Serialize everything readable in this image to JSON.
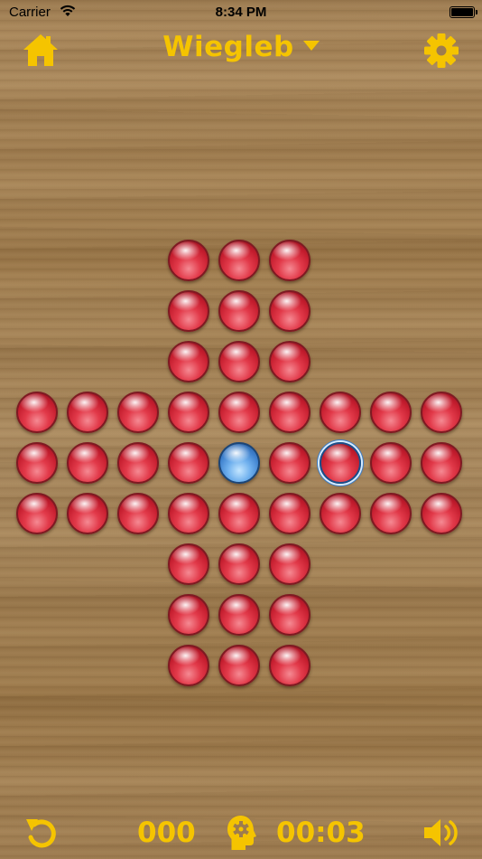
{
  "status_bar": {
    "carrier": "Carrier",
    "time": "8:34 PM",
    "icons": [
      "wifi-icon",
      "battery-icon"
    ]
  },
  "header": {
    "title": "Wiegleb",
    "home_icon": "home-icon",
    "settings_icon": "gear-icon",
    "dropdown_icon": "chevron-down-icon"
  },
  "board": {
    "layout": "cross",
    "grid_size": 9,
    "peg_color": "#d92a3c",
    "empty_hole_color": "#4f91dd",
    "selection_ring_color": "#3e7dc4",
    "rows": [
      "...XXX...",
      "...XXX...",
      "...XXX...",
      "XXXXXXXXX",
      "XXXXOXSXX",
      "XXXXXXXXX",
      "...XXX...",
      "...XXX...",
      "...XXX..."
    ],
    "legend_note_internal": null
  },
  "footer": {
    "undo_icon": "undo-icon",
    "moves": "000",
    "hint_icon": "hint-head-gear-icon",
    "timer": "00:03",
    "sound_icon": "speaker-icon"
  },
  "colors": {
    "accent": "#f5c400",
    "wood": "#9c7a4c"
  }
}
